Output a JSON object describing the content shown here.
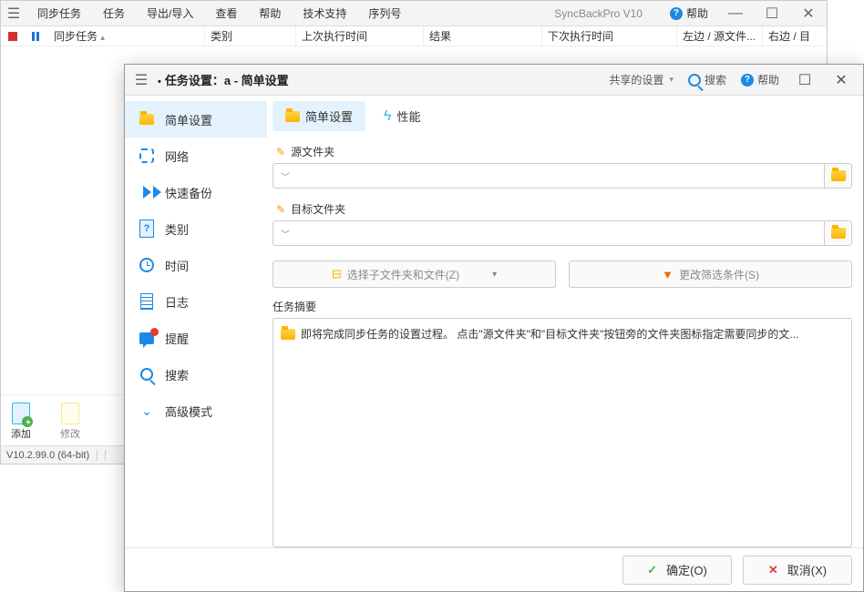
{
  "main": {
    "menu": [
      "同步任务",
      "任务",
      "导出/导入",
      "查看",
      "帮助",
      "技术支持",
      "序列号"
    ],
    "app_title": "SyncBackPro V10",
    "help_label": "帮助",
    "columns": [
      "同步任务",
      "类别",
      "上次执行时间",
      "结果",
      "下次执行时间",
      "左边 / 源文件...",
      "右边 / 目"
    ],
    "toolbar": {
      "add": "添加",
      "edit": "修改"
    },
    "status": "V10.2.99.0 (64-bit)"
  },
  "dialog": {
    "title_prefix": "任务设置：",
    "title_profile": "a - 简单设置",
    "shared_settings": "共享的设置",
    "search": "搜索",
    "help": "帮助",
    "sidebar": [
      {
        "id": "simple",
        "label": "简单设置"
      },
      {
        "id": "network",
        "label": "网络"
      },
      {
        "id": "fastbackup",
        "label": "快速备份"
      },
      {
        "id": "category",
        "label": "类别"
      },
      {
        "id": "time",
        "label": "时间"
      },
      {
        "id": "log",
        "label": "日志"
      },
      {
        "id": "remind",
        "label": "提醒"
      },
      {
        "id": "search",
        "label": "搜索"
      },
      {
        "id": "advanced",
        "label": "高级模式"
      }
    ],
    "tabs": {
      "simple": "简单设置",
      "perf": "性能"
    },
    "source_label": "源文件夹",
    "dest_label": "目标文件夹",
    "choose_subfolders": "选择子文件夹和文件(Z)",
    "change_filter": "更改筛选条件(S)",
    "summary_label": "任务摘要",
    "summary_text": "即将完成同步任务的设置过程。 点击\"源文件夹\"和\"目标文件夹\"按钮旁的文件夹图标指定需要同步的文...",
    "ok": "确定(O)",
    "cancel": "取消(X)"
  }
}
